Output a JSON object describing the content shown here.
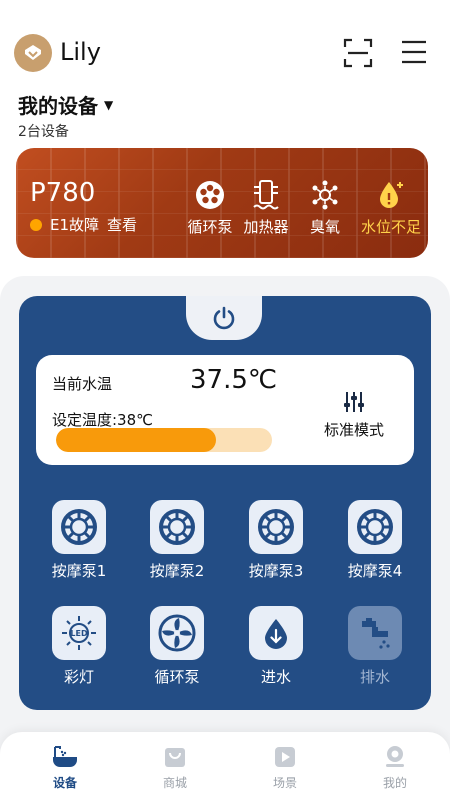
{
  "user": {
    "name": "Lily"
  },
  "devices": {
    "title": "我的设备",
    "count": "2台设备"
  },
  "banner": {
    "model": "P780",
    "fault": "E1故障",
    "view": "查看",
    "features": [
      {
        "label": "循环泵",
        "icon": "circulation-pump-icon"
      },
      {
        "label": "加热器",
        "icon": "heater-icon"
      },
      {
        "label": "臭氧",
        "icon": "ozone-icon"
      },
      {
        "label": "水位不足",
        "icon": "water-level-warning-icon",
        "warn": true
      }
    ]
  },
  "control": {
    "current_label": "当前水温",
    "current_value": "37.5℃",
    "set_label": "设定温度:38℃",
    "set_level_percent": 74,
    "mode_label": "标准模式",
    "buttons": [
      {
        "label": "按摩泵1",
        "icon": "massage-pump-icon"
      },
      {
        "label": "按摩泵2",
        "icon": "massage-pump-icon"
      },
      {
        "label": "按摩泵3",
        "icon": "massage-pump-icon"
      },
      {
        "label": "按摩泵4",
        "icon": "massage-pump-icon"
      },
      {
        "label": "彩灯",
        "icon": "led-light-icon"
      },
      {
        "label": "循环泵",
        "icon": "circulation-pump-icon"
      },
      {
        "label": "进水",
        "icon": "water-inlet-icon"
      },
      {
        "label": "排水",
        "icon": "drain-icon",
        "disabled": true
      }
    ]
  },
  "tabbar": {
    "items": [
      {
        "label": "设备",
        "icon": "bathtub-icon",
        "active": true
      },
      {
        "label": "商城",
        "icon": "shopping-bag-icon"
      },
      {
        "label": "场景",
        "icon": "play-icon"
      },
      {
        "label": "我的",
        "icon": "profile-icon"
      }
    ]
  },
  "colors": {
    "panel": "#234d85",
    "accent": "#f89a0b",
    "banner": "#a03a14",
    "warning": "#ffd24a"
  }
}
